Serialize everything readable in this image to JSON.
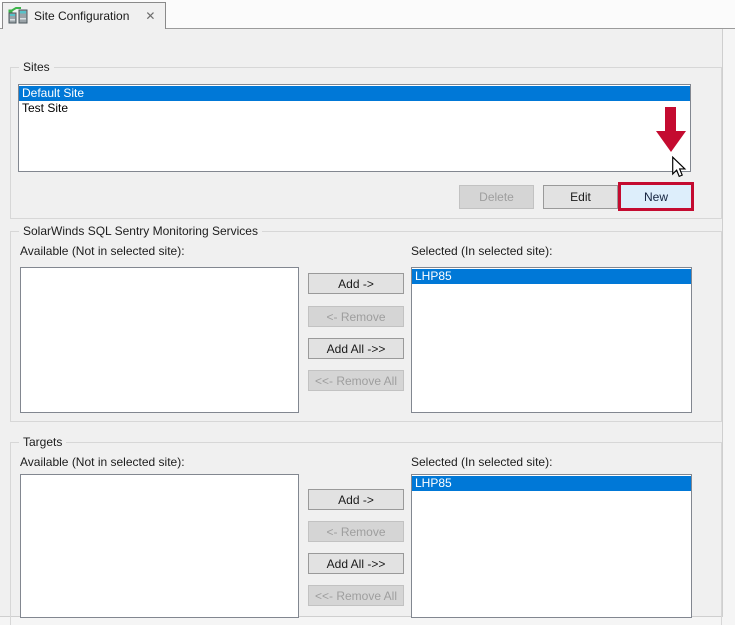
{
  "tab": {
    "title": "Site Configuration",
    "close_glyph": "✕"
  },
  "sites": {
    "group_label": "Sites",
    "items": [
      {
        "label": "Default Site",
        "selected": true
      },
      {
        "label": "Test Site",
        "selected": false
      }
    ],
    "buttons": {
      "delete": "Delete",
      "edit": "Edit",
      "new": "New"
    }
  },
  "services": {
    "group_label": "SolarWinds SQL Sentry Monitoring Services",
    "available_label": "Available (Not in selected site):",
    "selected_label": "Selected (In selected site):",
    "available_items": [],
    "selected_items": [
      {
        "label": "LHP85",
        "selected": true
      }
    ],
    "buttons": {
      "add": "Add ->",
      "remove": "<- Remove",
      "add_all": "Add All ->>",
      "remove_all": "<<- Remove All"
    }
  },
  "targets": {
    "group_label": "Targets",
    "available_label": "Available (Not in selected site):",
    "selected_label": "Selected (In selected site):",
    "available_items": [],
    "selected_items": [
      {
        "label": "LHP85",
        "selected": true
      }
    ],
    "buttons": {
      "add": "Add ->",
      "remove": "<- Remove",
      "add_all": "Add All ->>",
      "remove_all": "<<- Remove All"
    }
  },
  "colors": {
    "annotation_red": "#c40b30",
    "selection_blue": "#0078d7",
    "hover_button_bg": "#ddeefb"
  }
}
